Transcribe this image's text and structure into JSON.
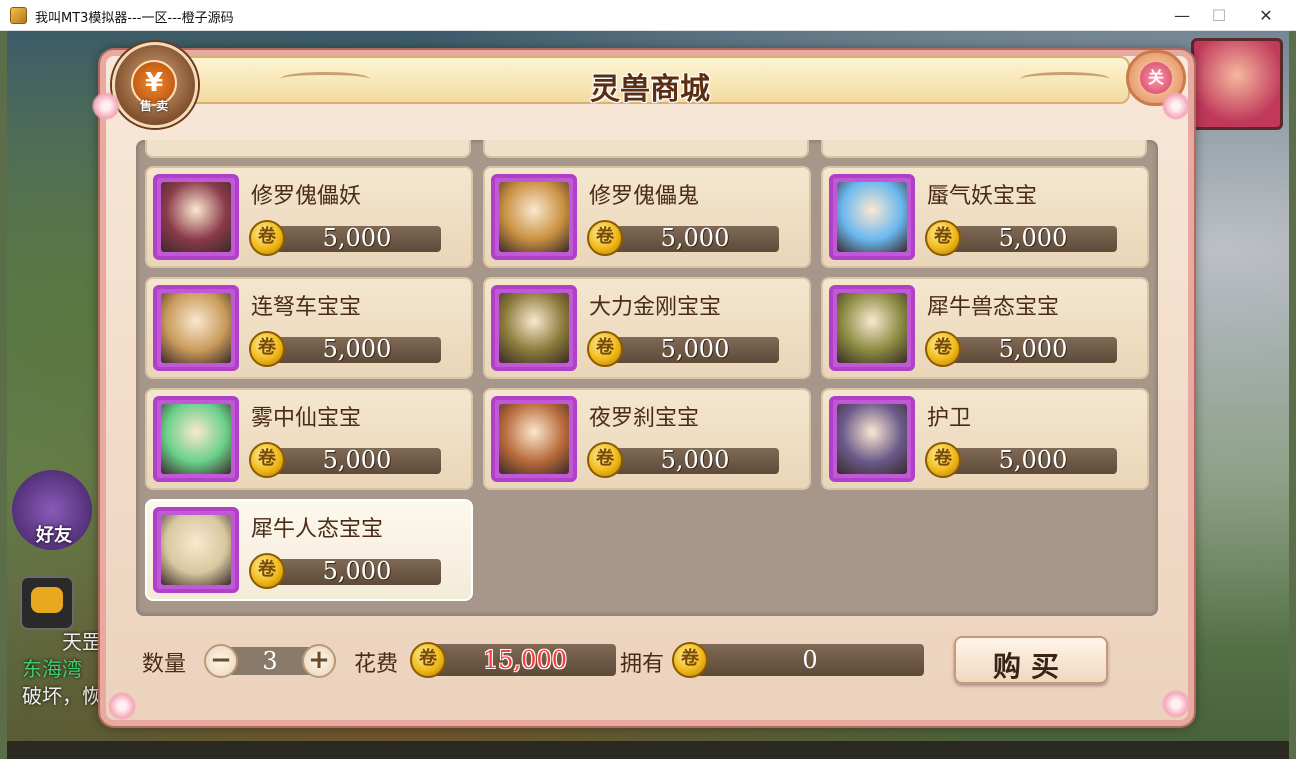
{
  "window": {
    "title": "我叫MT3模拟器---一区---橙子源码",
    "minimize": "—",
    "maximize": "☐",
    "close": "✕"
  },
  "game_background": {
    "friend_label": "好友",
    "side_text": [
      "天罡",
      "东海湾",
      "破坏，恢"
    ]
  },
  "shop": {
    "title": "灵兽商城",
    "sell_label": "售 卖",
    "sell_icon_glyph": "¥",
    "close_icon_glyph": "关",
    "coin_glyph": "卷",
    "pets": [
      {
        "name": "修罗傀儡妖",
        "price": "5,000",
        "portrait": "demon-woman",
        "color": "#8a3a4a"
      },
      {
        "name": "修罗傀儡鬼",
        "price": "5,000",
        "portrait": "golden-warrior",
        "color": "#c89040"
      },
      {
        "name": "蜃气妖宝宝",
        "price": "5,000",
        "portrait": "blue-spirit",
        "color": "#6ab8f0"
      },
      {
        "name": "连弩车宝宝",
        "price": "5,000",
        "portrait": "wooden-golem",
        "color": "#c89a5a"
      },
      {
        "name": "大力金刚宝宝",
        "price": "5,000",
        "portrait": "gold-strongman",
        "color": "#8a7a3a"
      },
      {
        "name": "犀牛兽态宝宝",
        "price": "5,000",
        "portrait": "rhino-beast",
        "color": "#8a8a40"
      },
      {
        "name": "雾中仙宝宝",
        "price": "5,000",
        "portrait": "green-fairy",
        "color": "#6ad08a"
      },
      {
        "name": "夜罗刹宝宝",
        "price": "5,000",
        "portrait": "purple-rakshasa",
        "color": "#b86a3a"
      },
      {
        "name": "护卫",
        "price": "5,000",
        "portrait": "guard",
        "color": "#6a5a8a"
      },
      {
        "name": "犀牛人态宝宝",
        "price": "5,000",
        "portrait": "rhino-human",
        "color": "#d8c8a0",
        "selected": true
      }
    ]
  },
  "purchase": {
    "quantity_label": "数量",
    "quantity": "3",
    "minus": "−",
    "plus": "+",
    "cost_label": "花费",
    "cost": "15,000",
    "owned_label": "拥有",
    "owned": "0",
    "buy_label": "购买"
  },
  "colors": {
    "panel_border": "#e7a9a0",
    "portrait_frame": "#b040c8",
    "price_bar": "#6e5a46",
    "cost_text": "#ff3a3a"
  }
}
